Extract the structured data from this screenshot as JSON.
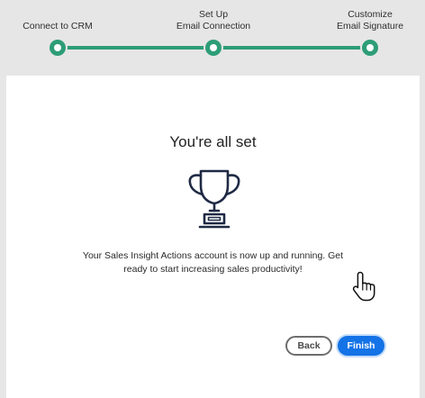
{
  "stepper": {
    "steps": [
      {
        "lines": [
          "Connect to CRM"
        ]
      },
      {
        "lines": [
          "Set Up",
          "Email Connection"
        ]
      },
      {
        "lines": [
          "Customize",
          "Email Signature"
        ]
      }
    ],
    "accent_color": "#2d9d78"
  },
  "main": {
    "title": "You're all set",
    "icon": "trophy-icon",
    "message_lines": [
      "Your Sales Insight Actions account is now up and running. Get",
      "ready to start increasing sales productivity!"
    ]
  },
  "footer": {
    "back_label": "Back",
    "finish_label": "Finish",
    "primary_color": "#1473e6"
  },
  "cursor": "hand-pointer-icon"
}
